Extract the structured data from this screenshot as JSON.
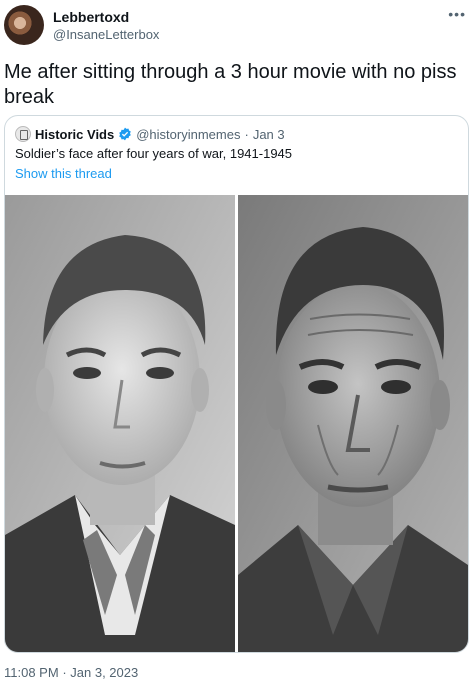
{
  "tweet": {
    "display_name": "Lebbertoxd",
    "handle": "@InsaneLetterbox",
    "more_icon": "more-horizontal-icon",
    "text": "Me after sitting through a 3 hour movie with no piss break",
    "timestamp": "11:08 PM",
    "separator": "·",
    "date": "Jan 3, 2023"
  },
  "quote": {
    "display_name": "Historic Vids",
    "verified_icon": "verified-badge-icon",
    "handle": "@historyinmemes",
    "separator": "·",
    "date": "Jan 3",
    "text": "Soldier’s face after four years of war, 1941-1945",
    "thread_link": "Show this thread"
  },
  "colors": {
    "link": "#1d9bf0",
    "secondary_text": "#536471",
    "border": "#cfd9de"
  }
}
